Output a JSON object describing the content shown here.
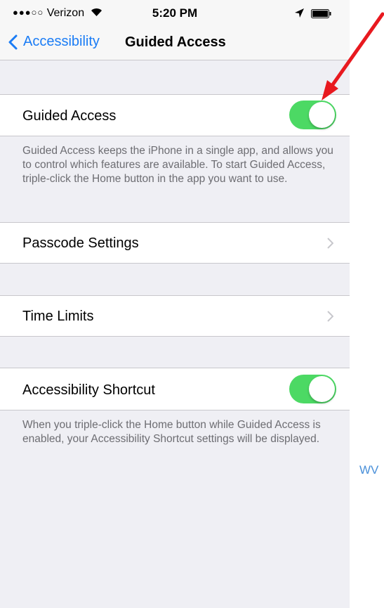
{
  "status": {
    "carrier_dots": "●●●○○",
    "carrier": "Verizon",
    "time": "5:20 PM"
  },
  "nav": {
    "back_label": "Accessibility",
    "title": "Guided Access"
  },
  "settings": {
    "guided_access": {
      "label": "Guided Access",
      "on": true
    },
    "guided_access_footer": "Guided Access keeps the iPhone in a single app, and allows you to control which features are available. To start Guided Access, triple-click the Home button in the app you want to use.",
    "passcode_settings": {
      "label": "Passcode Settings"
    },
    "time_limits": {
      "label": "Time Limits"
    },
    "accessibility_shortcut": {
      "label": "Accessibility Shortcut",
      "on": true
    },
    "shortcut_footer": "When you triple-click the Home button while Guided Access is enabled, your Accessibility Shortcut settings will be displayed."
  },
  "watermark": "WV",
  "colors": {
    "tint": "#1a7cf5",
    "toggle_on": "#4cd964",
    "annotation_arrow": "#e8191f"
  }
}
